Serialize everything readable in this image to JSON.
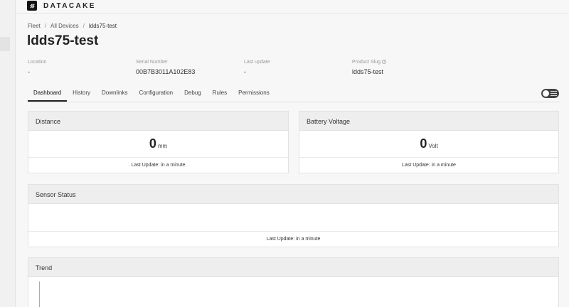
{
  "brand": {
    "name": "DATACAKE"
  },
  "breadcrumb": {
    "fleet": "Fleet",
    "all_devices": "All Devices",
    "current": "ldds75-test",
    "sep": "/"
  },
  "page": {
    "title": "ldds75-test"
  },
  "meta": {
    "location": {
      "label": "Location",
      "value": "-"
    },
    "serial": {
      "label": "Serial Number",
      "value": "00B7B3011A102E83"
    },
    "last_update": {
      "label": "Last update",
      "value": "-"
    },
    "slug": {
      "label": "Product Slug",
      "help": "?",
      "value": "ldds75-test"
    }
  },
  "tabs": [
    "Dashboard",
    "History",
    "Downlinks",
    "Configuration",
    "Debug",
    "Rules",
    "Permissions"
  ],
  "active_tab": "Dashboard",
  "widgets": {
    "distance": {
      "title": "Distance",
      "value": "0",
      "unit": "mm",
      "footer": "Last Update: in a minute"
    },
    "battery": {
      "title": "Battery Voltage",
      "value": "0",
      "unit": "Volt",
      "footer": "Last Update: in a minute"
    },
    "sensor_status": {
      "title": "Sensor Status",
      "footer": "Last Update: in a minute"
    },
    "trend": {
      "title": "Trend"
    }
  },
  "colors": {
    "accent": "#222222",
    "trend_line": "#e6a04a"
  }
}
